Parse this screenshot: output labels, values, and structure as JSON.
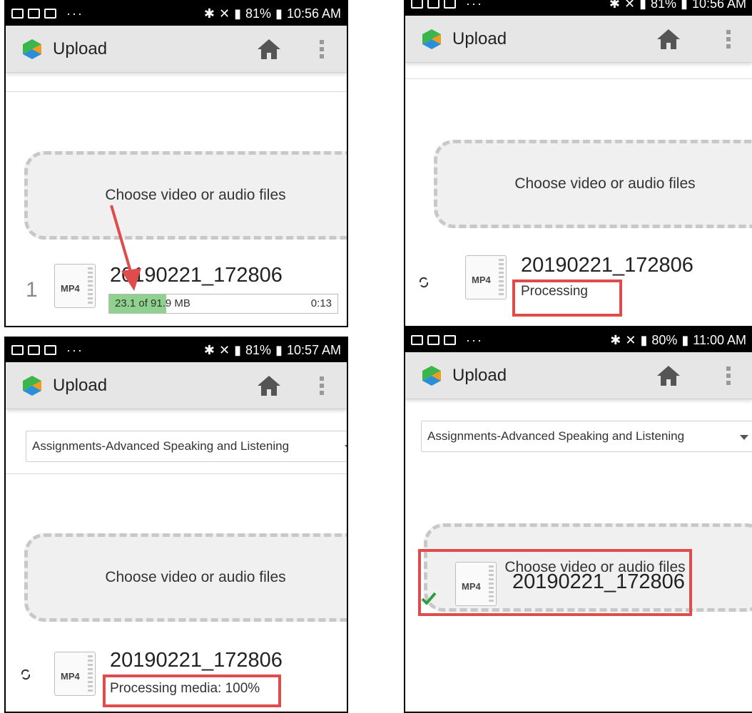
{
  "panels": [
    {
      "status_bar": {
        "battery": "81%",
        "time": "10:56 AM"
      },
      "title": "Upload",
      "dropzone_label": "Choose video or audio files",
      "file": {
        "index": "1",
        "type": "MP4",
        "name": "20190221_172806",
        "progress_text": "23.1 of 91.9 MB",
        "time_left": "0:13",
        "progress_fraction": 0.25
      }
    },
    {
      "status_bar": {
        "battery": "81%",
        "time": "10:56 AM"
      },
      "title": "Upload",
      "dropzone_label": "Choose video or audio files",
      "file": {
        "type": "MP4",
        "name": "20190221_172806",
        "status": "Processing"
      }
    },
    {
      "status_bar": {
        "battery": "81%",
        "time": "10:57 AM"
      },
      "title": "Upload",
      "folder": "Assignments-Advanced Speaking and Listening",
      "dropzone_label": "Choose video or audio files",
      "file": {
        "type": "MP4",
        "name": "20190221_172806",
        "status": "Processing media: 100%"
      }
    },
    {
      "status_bar": {
        "battery": "80%",
        "time": "11:00 AM"
      },
      "title": "Upload",
      "folder": "Assignments-Advanced Speaking and Listening",
      "dropzone_label": "Choose video or audio files",
      "file": {
        "type": "MP4",
        "name": "20190221_172806"
      }
    }
  ],
  "colors": {
    "highlight": "#e04b4b",
    "progress_fill": "#8fd18f",
    "logo_green": "#3cb54a",
    "logo_orange": "#f29b1d",
    "logo_blue": "#2a8fd6",
    "check_green": "#2e9e3f"
  },
  "icons": [
    "logo-icon",
    "home-icon",
    "more-vert-icon",
    "sync-icon",
    "mp4-file-icon",
    "check-icon",
    "dropdown-caret-icon"
  ]
}
